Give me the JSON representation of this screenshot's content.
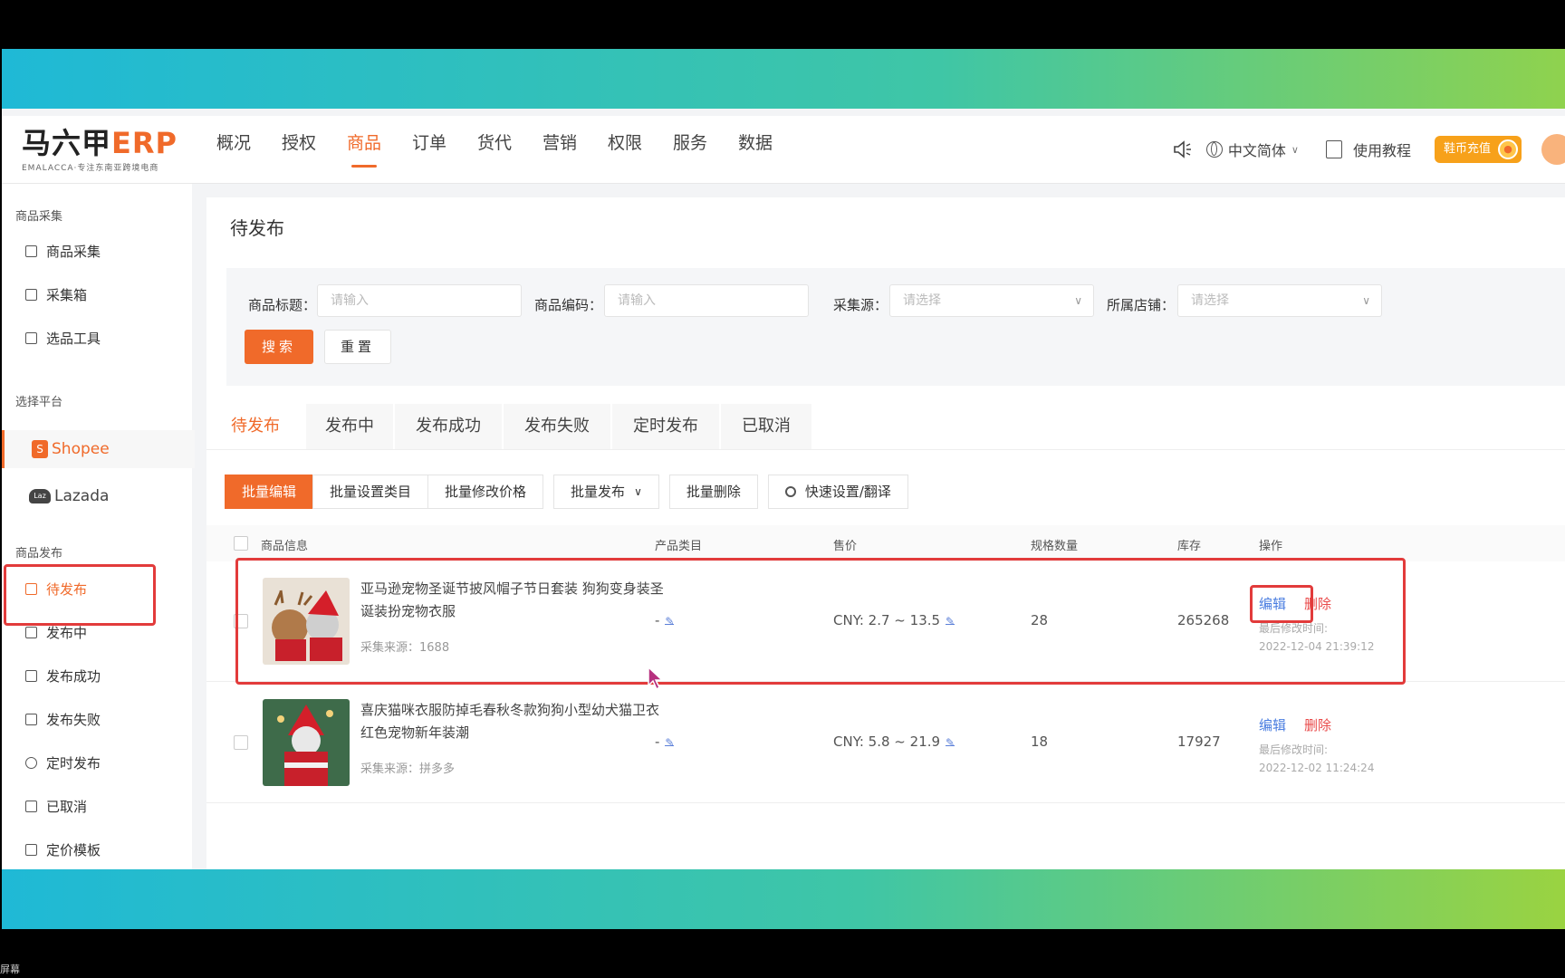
{
  "caption": "屏幕",
  "logo": {
    "main": "马六甲",
    "accent": "ERP",
    "sub": "EMALACCA·专注东南亚跨境电商"
  },
  "nav": {
    "items": [
      "概况",
      "授权",
      "商品",
      "订单",
      "货代",
      "营销",
      "权限",
      "服务",
      "数据"
    ],
    "active_index": 2,
    "language": "中文简体",
    "tutorial": "使用教程",
    "recharge": "鞋币充值"
  },
  "sidebar": {
    "group_collect": "商品采集",
    "collect_items": [
      "商品采集",
      "采集箱",
      "选品工具"
    ],
    "group_platform": "选择平台",
    "platforms": [
      "Shopee",
      "Lazada"
    ],
    "group_publish": "商品发布",
    "publish_items": [
      "待发布",
      "发布中",
      "发布成功",
      "发布失败",
      "定时发布",
      "已取消",
      "定价模板"
    ]
  },
  "main": {
    "title": "待发布",
    "filters": {
      "title_label": "商品标题：",
      "title_placeholder": "请输入",
      "code_label": "商品编码：",
      "code_placeholder": "请输入",
      "source_label": "采集源：",
      "source_placeholder": "请选择",
      "shop_label": "所属店铺：",
      "shop_placeholder": "请选择",
      "search": "搜索",
      "reset": "重置"
    },
    "tabs": [
      "待发布",
      "发布中",
      "发布成功",
      "发布失败",
      "定时发布",
      "已取消"
    ],
    "toolbar": {
      "batch_edit": "批量编辑",
      "batch_category": "批量设置类目",
      "batch_price": "批量修改价格",
      "batch_publish": "批量发布",
      "batch_delete": "批量删除",
      "quick_settings": "快速设置/翻译"
    },
    "table": {
      "headers": [
        "商品信息",
        "产品类目",
        "售价",
        "规格数量",
        "库存",
        "操作"
      ],
      "rows": [
        {
          "title": "亚马逊宠物圣诞节披风帽子节日套装 狗狗变身装圣诞装扮宠物衣服",
          "source": "采集来源：1688",
          "category": "-",
          "price": "CNY: 2.7 ~ 13.5",
          "spec_count": "28",
          "stock": "265268",
          "edit": "编辑",
          "delete": "删除",
          "modified_label": "最后修改时间:",
          "modified_time": "2022-12-04 21:39:12"
        },
        {
          "title": "喜庆猫咪衣服防掉毛春秋冬款狗狗小型幼犬猫卫衣红色宠物新年装潮",
          "source": "采集来源：拼多多",
          "category": "-",
          "price": "CNY: 5.8 ~ 21.9",
          "spec_count": "18",
          "stock": "17927",
          "edit": "编辑",
          "delete": "删除",
          "modified_label": "最后修改时间:",
          "modified_time": "2022-12-02 11:24:24"
        }
      ]
    }
  },
  "colors": {
    "accent": "#f06a2a",
    "highlight": "#e23b3b",
    "link": "#4a7de0",
    "danger": "#e94a4a"
  }
}
